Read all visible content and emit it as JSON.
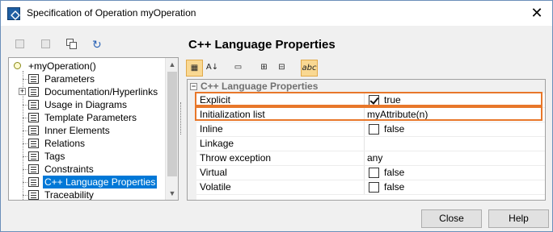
{
  "window": {
    "title": "Specification of Operation myOperation",
    "close_glyph": "✕"
  },
  "left_toolbar": {
    "icons": [
      "expand-icon",
      "collapse-icon",
      "copy-icon",
      "refresh-icon"
    ]
  },
  "right_panel": {
    "title": "C++ Language Properties"
  },
  "tree": {
    "root": "+myOperation()",
    "items": [
      "Parameters",
      "Documentation/Hyperlinks",
      "Usage in Diagrams",
      "Template Parameters",
      "Inner Elements",
      "Relations",
      "Tags",
      "Constraints",
      "C++ Language Properties",
      "Traceability"
    ],
    "selected": "C++ Language Properties"
  },
  "prop_toolbar": {
    "icons": [
      "categorized-icon",
      "sort-az-icon",
      "shortcut-icon",
      "expand-all-icon",
      "collapse-all-icon",
      "abc-filter-icon"
    ]
  },
  "grid": {
    "group": "C++ Language Properties",
    "rows": [
      {
        "name": "Explicit",
        "value": "true",
        "checkbox": true,
        "checked": true,
        "highlight": true
      },
      {
        "name": "Initialization list",
        "value": "myAttribute(n)",
        "checkbox": false,
        "highlight": true
      },
      {
        "name": "Inline",
        "value": "false",
        "checkbox": true,
        "checked": false
      },
      {
        "name": "Linkage",
        "value": "",
        "checkbox": false
      },
      {
        "name": "Throw exception",
        "value": "any",
        "checkbox": false
      },
      {
        "name": "Virtual",
        "value": "false",
        "checkbox": true,
        "checked": false
      },
      {
        "name": "Volatile",
        "value": "false",
        "checkbox": true,
        "checked": false
      }
    ]
  },
  "buttons": {
    "close": "Close",
    "help": "Help"
  },
  "colors": {
    "highlight": "#e8772a",
    "selection": "#0078d7",
    "active_tool": "#f9d892"
  }
}
